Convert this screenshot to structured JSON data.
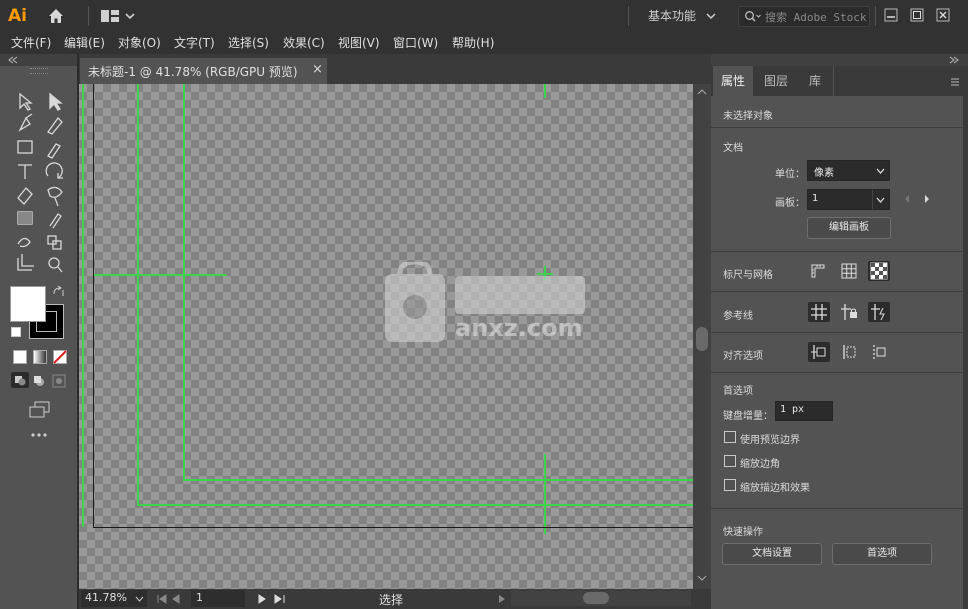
{
  "app": {
    "logo": "Ai"
  },
  "titlebar": {
    "workspace": "基本功能",
    "search_placeholder": "搜索 Adobe Stock"
  },
  "menu": [
    "文件(F)",
    "编辑(E)",
    "对象(O)",
    "文字(T)",
    "选择(S)",
    "效果(C)",
    "视图(V)",
    "窗口(W)",
    "帮助(H)"
  ],
  "document": {
    "tab_title": "未标题-1 @ 41.78% (RGB/GPU 预览)",
    "close": "×"
  },
  "status": {
    "zoom": "41.78%",
    "artboard": "1",
    "tool": "选择"
  },
  "right_panel": {
    "tabs": [
      "属性",
      "图层",
      "库"
    ],
    "no_selection": "未选择对象",
    "doc_section": "文档",
    "units_label": "单位：",
    "units_value": "像素",
    "artboard_label": "画板：",
    "artboard_value": "1",
    "edit_artboards": "编辑画板",
    "rulers_grids": "标尺与网格",
    "guides": "参考线",
    "align_options": "对齐选项",
    "preferences": "首选项",
    "keyboard_increment_label": "键盘增量：",
    "keyboard_increment_value": "1 px",
    "checkboxes": [
      "使用预览边界",
      "缩放边角",
      "缩放描边和效果"
    ],
    "quick_actions": "快速操作",
    "doc_settings_btn": "文档设置",
    "prefs_btn": "首选项"
  },
  "watermark": {
    "text": "anxz.com"
  },
  "colors": {
    "accent_logo": "#ff9a00",
    "guide_green": "#3bd44a",
    "panel_bg": "#535353",
    "dark_bar": "#323232"
  }
}
